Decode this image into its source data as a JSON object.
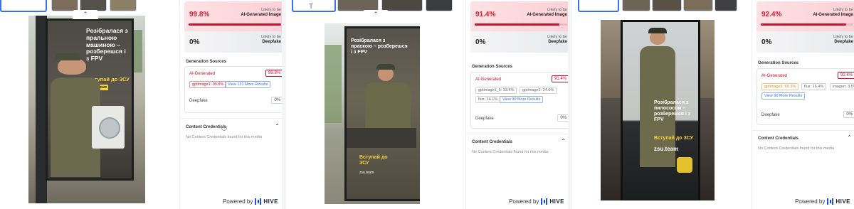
{
  "panels": [
    {
      "result": {
        "ai_percent": "99.8%",
        "ai_label_top": "Likely to be",
        "ai_label_bottom": "AI-Generated Image",
        "ai_level": 0.998,
        "df_percent": "0%",
        "df_label_top": "Likely to be",
        "df_label_bottom": "Deepfake",
        "gen_title": "Generation Sources",
        "gen_ai_label": "AI-Generated",
        "gen_ai_value": "99.8%",
        "chips": [
          "gptimage1: 99.8%",
          "View 131 More Results"
        ],
        "deepfake_label": "Deepfake",
        "deepfake_value": "0%",
        "cc_title": "Content Credentials",
        "cc_text": "No Content Credentials found for this media",
        "powered_by": "Powered by",
        "brand": "HIVE"
      },
      "poster": {
        "headline": "Розібралася з пральною машиною – розберешся і з FPV",
        "cta": "Вступай до ЗСУ",
        "site": "zsu.team"
      }
    },
    {
      "result": {
        "ai_percent": "91.4%",
        "ai_label_top": "Likely to be",
        "ai_label_bottom": "AI-Generated Image",
        "ai_level": 0.914,
        "df_percent": "0%",
        "df_label_top": "Likely to be",
        "df_label_bottom": "Deepfake",
        "gen_title": "Generation Sources",
        "gen_ai_label": "AI-Generated",
        "gen_ai_value": "91.4%",
        "chips": [
          "gptimage1_5: 33.4%",
          "gptimage1: 24.0%",
          "flux: 14.1%",
          "View 90 More Results"
        ],
        "deepfake_label": "Deepfake",
        "deepfake_value": "0%",
        "cc_title": "Content Credentials",
        "cc_text": "No Content Credentials found for this media",
        "powered_by": "Powered by",
        "brand": "HIVE"
      },
      "poster": {
        "headline": "Розібралася з праскою – розберешся і з FPV",
        "cta": "Вступай до ЗСУ",
        "site": "zsu.team"
      }
    },
    {
      "result": {
        "ai_percent": "92.4%",
        "ai_label_top": "Likely to be",
        "ai_label_bottom": "AI-Generated Image",
        "ai_level": 0.924,
        "df_percent": "0%",
        "df_label_top": "Likely to be",
        "df_label_bottom": "Deepfake",
        "gen_title": "Generation Sources",
        "gen_ai_label": "AI-Generated",
        "gen_ai_value": "92.4%",
        "chips": [
          "gptimage1: 60.3%",
          "flux: 16.4%",
          "imagen: 3.5%",
          "View 90 More Results"
        ],
        "deepfake_label": "Deepfake",
        "deepfake_value": "0%",
        "cc_title": "Content Credentials",
        "cc_text": "No Content Credentials found for this media",
        "powered_by": "Powered by",
        "brand": "HIVE"
      },
      "poster": {
        "headline": "Розібралася з пилососом – розберешся і з FPV",
        "cta": "Вступай до ЗСУ",
        "site": "zsu.team"
      }
    }
  ],
  "icons": {
    "collapse": "chevron-up-icon",
    "cc_toggle": "chevron-up-icon",
    "info": "info-icon",
    "brand": "hive-logo-icon"
  },
  "colors": {
    "ai_red": "#c8102e",
    "accent_blue": "#3a73e8",
    "poster_yellow": "#f6d23b"
  }
}
